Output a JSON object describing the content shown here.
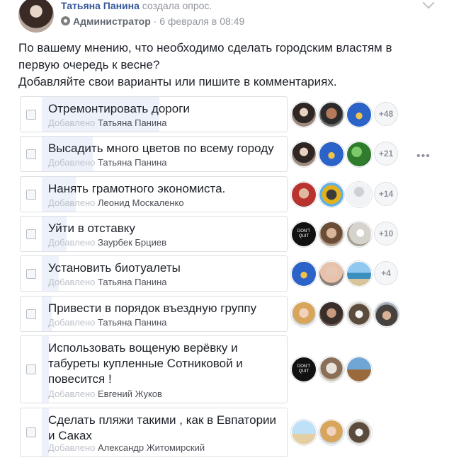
{
  "post": {
    "author_name": "Татьяна Панина",
    "author_action": "создала опрос.",
    "role": "Администратор",
    "date": "6 февраля в 08:49",
    "question_lines": [
      "По вашему мнению, что необходимо сделать городским властям в",
      "первую очередь к весне?",
      "Добавляйте свои варианты или пишите в комментариях."
    ]
  },
  "poll": {
    "added_prefix": "Добавлено",
    "options": [
      {
        "lines": [
          "Отремонтировать дороги"
        ],
        "added_by": "Татьяна Панина",
        "more": "+48",
        "fill": 0.48,
        "voters": [
          "woman-avatar",
          "man-avatar",
          "church-avatar"
        ]
      },
      {
        "lines": [
          "Высадить много цветов по всему городу"
        ],
        "added_by": "Татьяна Панина",
        "more": "+21",
        "fill": 0.21,
        "voters": [
          "woman-avatar",
          "church-avatar",
          "green-avatar"
        ]
      },
      {
        "lines": [
          "Нанять грамотного экономиста."
        ],
        "added_by": "Леонид Москаленко",
        "more": "+14",
        "fill": 0.14,
        "voters": [
          "red-avatar",
          "person-avatar",
          "blank-avatar"
        ]
      },
      {
        "lines": [
          "Уйти в отставку"
        ],
        "added_by": "Заурбек Брциев",
        "more": "+10",
        "fill": 0.1,
        "voters": [
          "dont-quit-avatar",
          "guy-avatar",
          "bird-avatar"
        ]
      },
      {
        "lines": [
          "Установить биотуалеты"
        ],
        "added_by": "Татьяна Панина",
        "more": "+4",
        "fill": 0.07,
        "voters": [
          "church-avatar",
          "bald-avatar",
          "sea-avatar"
        ]
      },
      {
        "lines": [
          "Привести в порядок въездную группу"
        ],
        "added_by": "Татьяна Панина",
        "more": "",
        "fill": 0.04,
        "voters": [
          "blonde-avatar",
          "dark-avatar",
          "group-avatar",
          "hat-avatar"
        ]
      },
      {
        "lines": [
          "Использовать вощеную верёвку и",
          "табуреты купленные Сотниковой и",
          "повесится !"
        ],
        "added_by": "Евгений Жуков",
        "more": "",
        "fill": 0.03,
        "voters": [
          "dont-quit-avatar",
          "old-man-avatar",
          "bridge-avatar"
        ]
      },
      {
        "lines": [
          "Сделать пляжи такими , как в Евпатории",
          "и Саках"
        ],
        "added_by": "Александр Житомирский",
        "more": "",
        "fill": 0.03,
        "voters": [
          "beach-avatar",
          "blonde-avatar",
          "group-avatar"
        ]
      }
    ]
  }
}
